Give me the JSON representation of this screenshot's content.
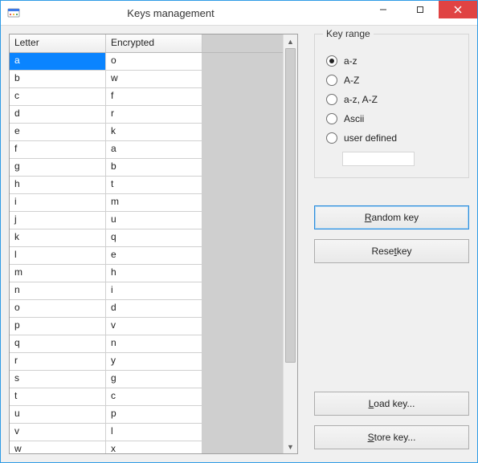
{
  "window": {
    "title": "Keys management"
  },
  "grid": {
    "headers": {
      "letter": "Letter",
      "encrypted": "Encrypted"
    },
    "rows": [
      {
        "letter": "a",
        "enc": "o",
        "selected": true
      },
      {
        "letter": "b",
        "enc": "w"
      },
      {
        "letter": "c",
        "enc": "f"
      },
      {
        "letter": "d",
        "enc": "r"
      },
      {
        "letter": "e",
        "enc": "k"
      },
      {
        "letter": "f",
        "enc": "a"
      },
      {
        "letter": "g",
        "enc": "b"
      },
      {
        "letter": "h",
        "enc": "t"
      },
      {
        "letter": "i",
        "enc": "m"
      },
      {
        "letter": "j",
        "enc": "u"
      },
      {
        "letter": "k",
        "enc": "q"
      },
      {
        "letter": "l",
        "enc": "e"
      },
      {
        "letter": "m",
        "enc": "h"
      },
      {
        "letter": "n",
        "enc": "i"
      },
      {
        "letter": "o",
        "enc": "d"
      },
      {
        "letter": "p",
        "enc": "v"
      },
      {
        "letter": "q",
        "enc": "n"
      },
      {
        "letter": "r",
        "enc": "y"
      },
      {
        "letter": "s",
        "enc": "g"
      },
      {
        "letter": "t",
        "enc": "c"
      },
      {
        "letter": "u",
        "enc": "p"
      },
      {
        "letter": "v",
        "enc": "l"
      },
      {
        "letter": "w",
        "enc": "x"
      }
    ]
  },
  "keyrange": {
    "title": "Key range",
    "options": [
      {
        "label": "a-z",
        "checked": true
      },
      {
        "label": "A-Z"
      },
      {
        "label": "a-z, A-Z"
      },
      {
        "label": "Ascii"
      },
      {
        "label": "user defined"
      }
    ],
    "userdef_value": ""
  },
  "buttons": {
    "random": {
      "pre": "",
      "ul": "R",
      "post": "andom key"
    },
    "reset": {
      "pre": "Rese",
      "ul": "t",
      "post": " key"
    },
    "load": {
      "pre": "",
      "ul": "L",
      "post": "oad key..."
    },
    "store": {
      "pre": "",
      "ul": "S",
      "post": "tore key..."
    }
  }
}
